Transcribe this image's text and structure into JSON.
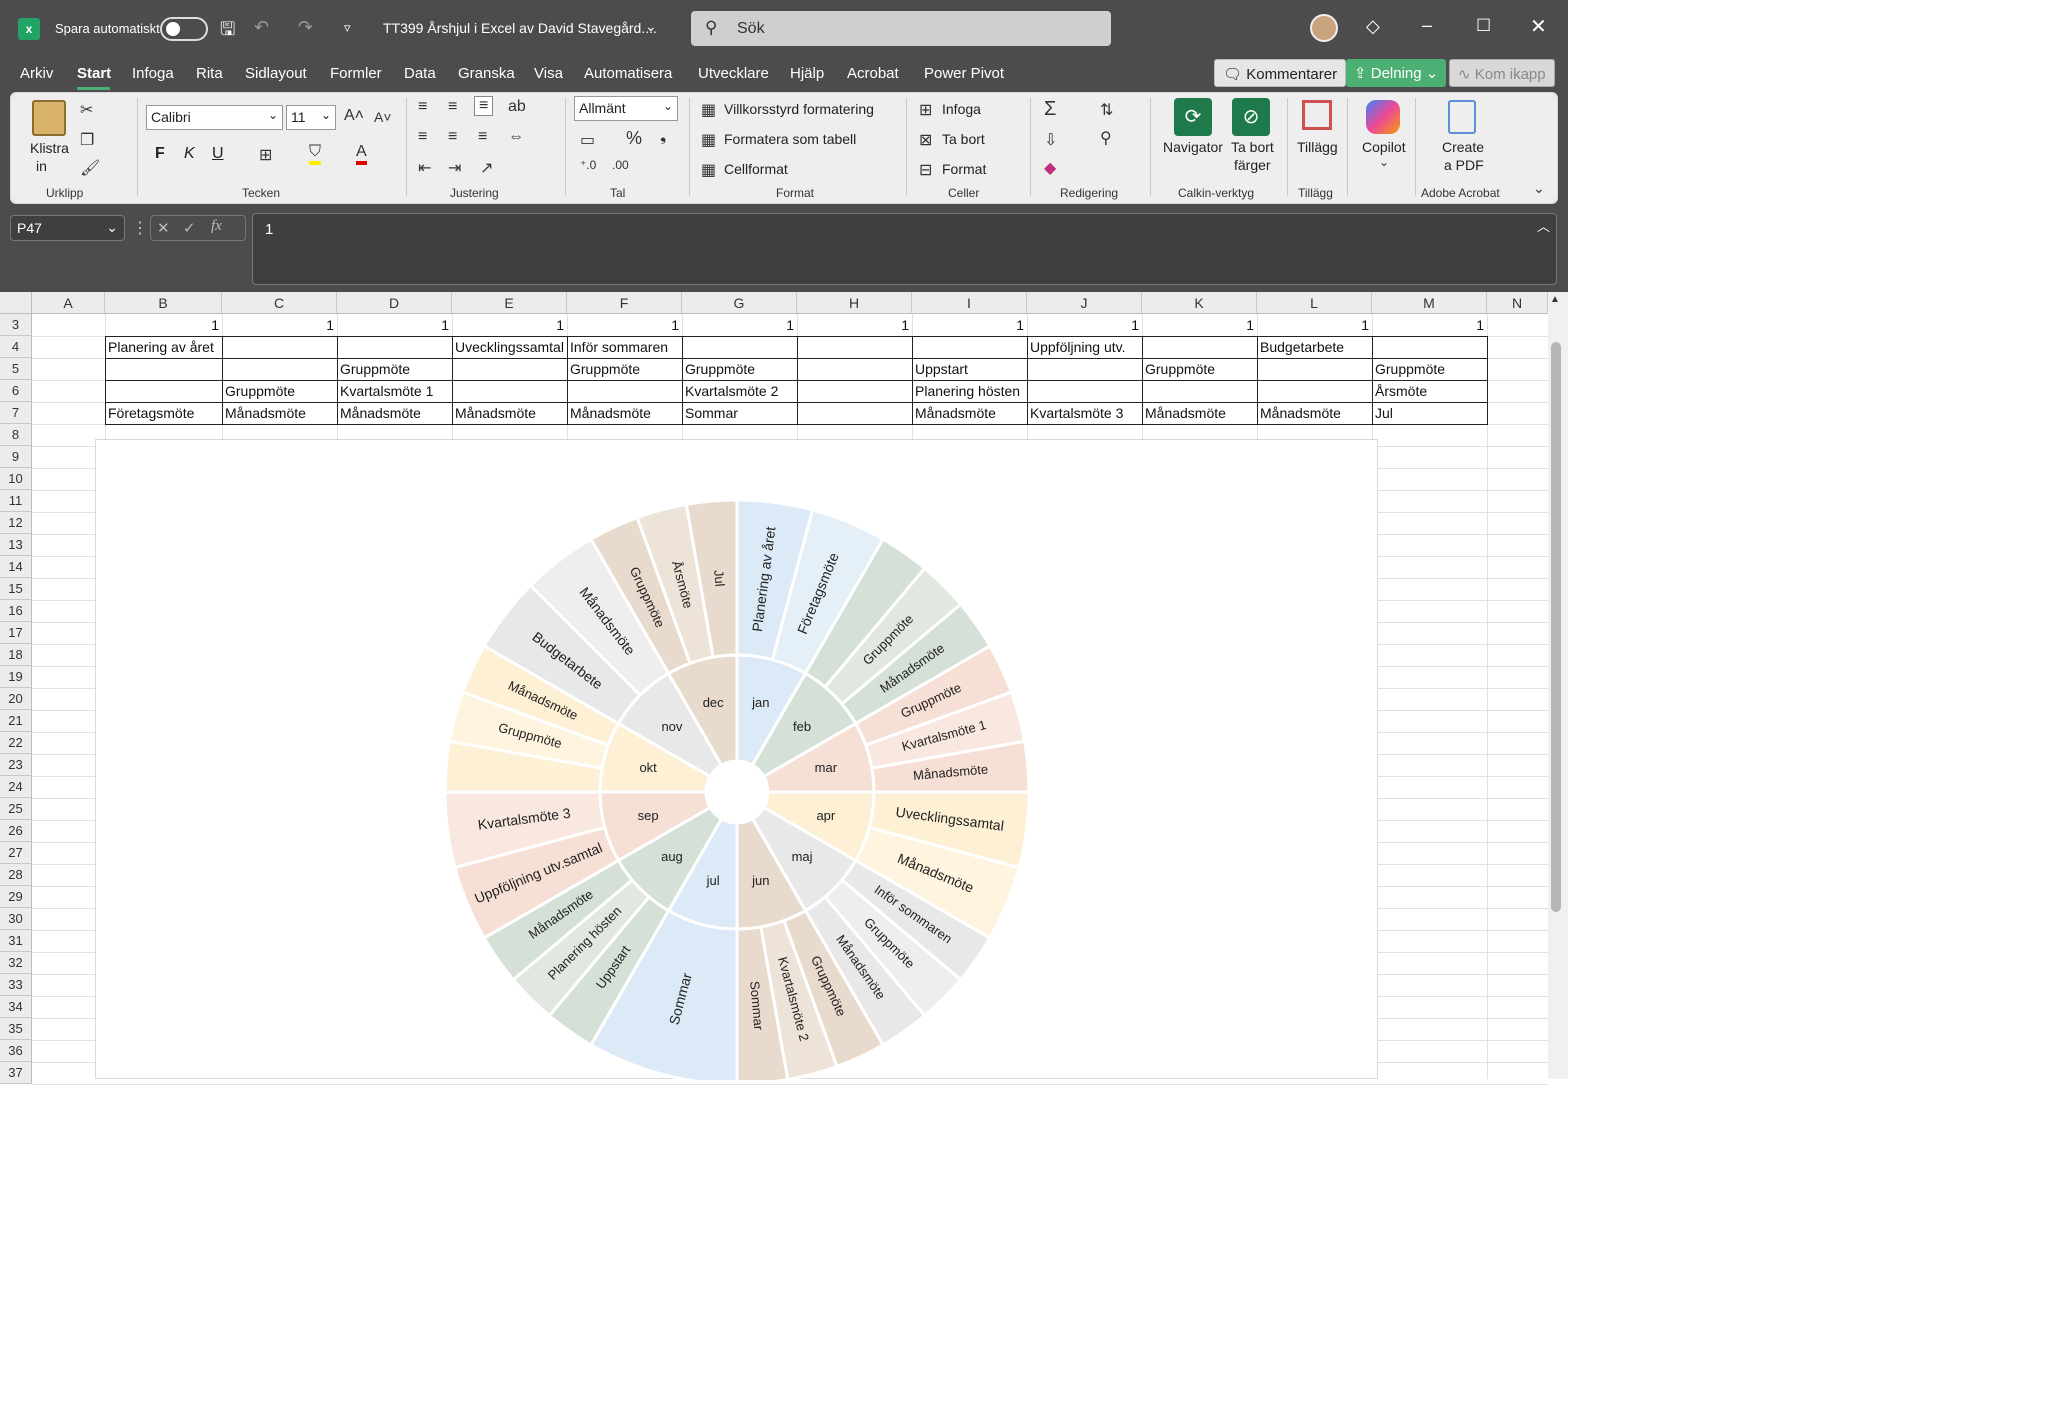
{
  "titlebar": {
    "autosave_label": "Spara automatiskt",
    "doc_title": "TT399 Årshjul i Excel av David Stavegård....",
    "search_placeholder": "Sök"
  },
  "menu": [
    "Arkiv",
    "Start",
    "Infoga",
    "Rita",
    "Sidlayout",
    "Formler",
    "Data",
    "Granska",
    "Visa",
    "Automatisera",
    "Utvecklare",
    "Hjälp",
    "Acrobat",
    "Power Pivot"
  ],
  "header_buttons": {
    "comments": "Kommentarer",
    "share": "Delning",
    "catchup": "Kom ikapp"
  },
  "ribbon": {
    "clipboard": {
      "paste": "Klistra",
      "paste2": "in",
      "group": "Urklipp"
    },
    "font": {
      "name": "Calibri",
      "size": "11",
      "bold": "F",
      "italic": "K",
      "underline": "U",
      "group": "Tecken"
    },
    "alignment": {
      "group": "Justering"
    },
    "number": {
      "format": "Allmänt",
      "group": "Tal"
    },
    "styles": {
      "conditional": "Villkorsstyrd formatering",
      "table": "Formatera som tabell",
      "cellstyle": "Cellformat",
      "group": "Format"
    },
    "cells": {
      "insert": "Infoga",
      "delete": "Ta bort",
      "format": "Format",
      "group": "Celler"
    },
    "editing": {
      "group": "Redigering"
    },
    "calkin": {
      "navigator": "Navigator",
      "remove1": "Ta bort",
      "remove2": "färger",
      "group": "Calkin-verktyg"
    },
    "addins": {
      "label": "Tillägg",
      "group": "Tillägg"
    },
    "copilot": {
      "label": "Copilot"
    },
    "acrobat": {
      "create1": "Create",
      "create2": "a PDF",
      "group": "Adobe Acrobat"
    }
  },
  "formula_bar": {
    "name_box": "P47",
    "formula": "1"
  },
  "columns": [
    "A",
    "B",
    "C",
    "D",
    "E",
    "F",
    "G",
    "H",
    "I",
    "J",
    "K",
    "L",
    "M",
    "N"
  ],
  "rows": [
    "3",
    "4",
    "5",
    "6",
    "7",
    "8",
    "9",
    "10",
    "11",
    "12",
    "13",
    "14",
    "15",
    "16",
    "17",
    "18",
    "19",
    "20",
    "21",
    "22",
    "23",
    "24",
    "25",
    "26",
    "27",
    "28",
    "29",
    "30",
    "31",
    "32",
    "33",
    "34",
    "35",
    "36",
    "37"
  ],
  "grid": {
    "row3": [
      "1",
      "1",
      "1",
      "1",
      "1",
      "1",
      "1",
      "1",
      "1",
      "1",
      "1",
      "1"
    ],
    "row4": [
      "Planering av året",
      "",
      "",
      "Uvecklingssamtal",
      "Inför sommaren",
      "",
      "",
      "",
      "Uppföljning utv.",
      "",
      "Budgetarbete",
      ""
    ],
    "row5": [
      "",
      "",
      "Gruppmöte",
      "",
      "Gruppmöte",
      "Gruppmöte",
      "",
      "Uppstart",
      "",
      "Gruppmöte",
      "",
      "Gruppmöte"
    ],
    "row6": [
      "",
      "Gruppmöte",
      "Kvartalsmöte 1",
      "",
      "",
      "Kvartalsmöte 2",
      "",
      "Planering hösten",
      "",
      "",
      "",
      "Årsmöte"
    ],
    "row7": [
      "Företagsmöte",
      "Månadsmöte",
      "Månadsmöte",
      "Månadsmöte",
      "Månadsmöte",
      "Sommar",
      "",
      "Månadsmöte",
      "Kvartalsmöte 3",
      "Månadsmöte",
      "Månadsmöte",
      "Jul"
    ]
  },
  "chart_data": {
    "type": "sunburst",
    "months": [
      {
        "name": "jan",
        "color": "#dce9f6",
        "items": [
          "Planering av året",
          "Företagsmöte"
        ]
      },
      {
        "name": "feb",
        "color": "#d5e0d6",
        "items": [
          "",
          "Gruppmöte",
          "Månadsmöte"
        ]
      },
      {
        "name": "mar",
        "color": "#f6e0d6",
        "items": [
          "Gruppmöte",
          "Kvartalsmöte 1",
          "Månadsmöte"
        ]
      },
      {
        "name": "apr",
        "color": "#fdf0d4",
        "items": [
          "Uvecklingssamtal",
          "Månadsmöte"
        ]
      },
      {
        "name": "maj",
        "color": "#e8e8e8",
        "items": [
          "Inför sommaren",
          "Gruppmöte",
          "Månadsmöte"
        ]
      },
      {
        "name": "jun",
        "color": "#e8dacc",
        "items": [
          "Gruppmöte",
          "Kvartalsmöte 2",
          "Sommar"
        ]
      },
      {
        "name": "jul",
        "color": "#dce9f6",
        "items": [
          "Sommar"
        ]
      },
      {
        "name": "aug",
        "color": "#d5e0d6",
        "items": [
          "Uppstart",
          "Planering hösten",
          "Månadsmöte"
        ]
      },
      {
        "name": "sep",
        "color": "#f6e0d6",
        "items": [
          "Uppföljning utv.samtal",
          "Kvartalsmöte 3"
        ]
      },
      {
        "name": "okt",
        "color": "#fdf0d4",
        "items": [
          "",
          "Gruppmöte",
          "Månadsmöte"
        ]
      },
      {
        "name": "nov",
        "color": "#e8e8e8",
        "items": [
          "Budgetarbete",
          "Månadsmöte"
        ]
      },
      {
        "name": "dec",
        "color": "#e8dacc",
        "items": [
          "Gruppmöte",
          "Årsmöte",
          "Jul"
        ]
      }
    ]
  }
}
